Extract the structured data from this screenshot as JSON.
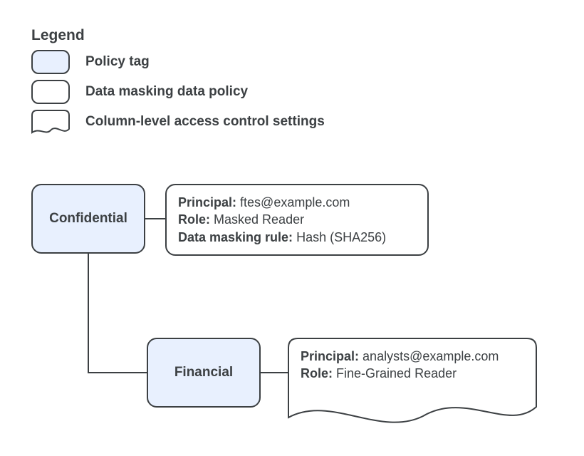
{
  "legend": {
    "title": "Legend",
    "items": [
      {
        "label": "Policy tag"
      },
      {
        "label": "Data masking data policy"
      },
      {
        "label": "Column-level access control settings"
      }
    ]
  },
  "nodes": {
    "confidential": {
      "tag_label": "Confidential",
      "policy": {
        "principal_label": "Principal:",
        "principal_value": "ftes@example.com",
        "role_label": "Role:",
        "role_value": "Masked Reader",
        "rule_label": "Data masking rule:",
        "rule_value": "Hash (SHA256)"
      }
    },
    "financial": {
      "tag_label": "Financial",
      "clac": {
        "principal_label": "Principal:",
        "principal_value": "analysts@example.com",
        "role_label": "Role:",
        "role_value": "Fine-Grained Reader"
      }
    }
  }
}
